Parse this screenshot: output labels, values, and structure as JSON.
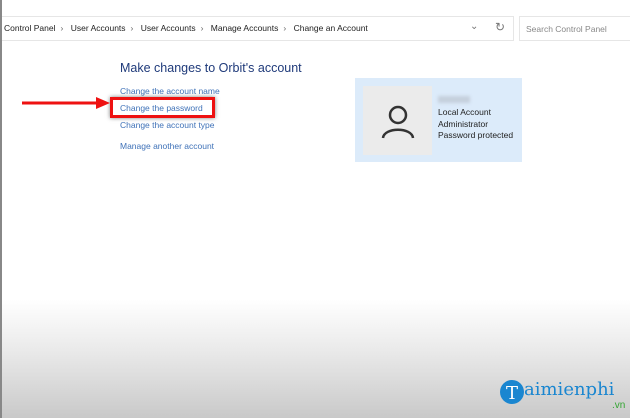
{
  "breadcrumb": [
    "Control Panel",
    "User Accounts",
    "User Accounts",
    "Manage Accounts",
    "Change an Account"
  ],
  "search": {
    "placeholder": "Search Control Panel"
  },
  "main": {
    "title": "Make changes to Orbit's account",
    "links": [
      "Change the account name",
      "Change the password",
      "Change the account type",
      "Manage another account"
    ]
  },
  "account": {
    "lines": [
      "Local Account",
      "Administrator",
      "Password protected"
    ]
  },
  "watermark": {
    "brand": "aimienphi",
    "suffix": ".vn"
  },
  "colors": {
    "highlight": "#ee1111",
    "link": "#3f72b8"
  }
}
